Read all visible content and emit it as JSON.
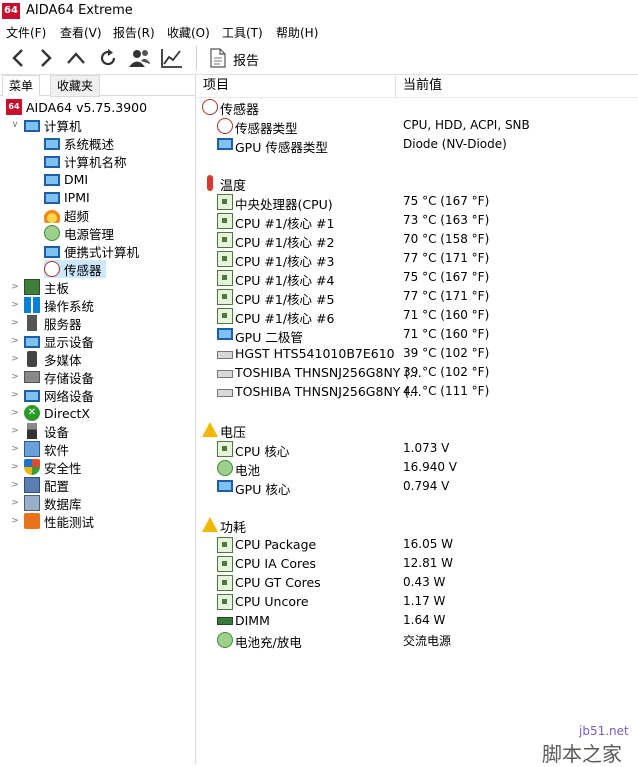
{
  "window": {
    "title": "AIDA64 Extreme",
    "logo": "64"
  },
  "menu": [
    "文件(F)",
    "查看(V)",
    "报告(R)",
    "收藏(O)",
    "工具(T)",
    "帮助(H)"
  ],
  "toolbar": {
    "buttons": [
      "back-icon",
      "forward-icon",
      "up-icon",
      "refresh-icon",
      "user-icon",
      "chart-icon"
    ],
    "report_label": "报告"
  },
  "tabs": {
    "menu": "菜单",
    "favorites": "收藏夹"
  },
  "tree": {
    "root": "AIDA64 v5.75.3900",
    "computer": "计算机",
    "computer_children": [
      "系统概述",
      "计算机名称",
      "DMI",
      "IPMI",
      "超频",
      "电源管理",
      "便携式计算机",
      "传感器"
    ],
    "top_items": [
      "主板",
      "操作系统",
      "服务器",
      "显示设备",
      "多媒体",
      "存储设备",
      "网络设备",
      "DirectX",
      "设备",
      "软件",
      "安全性",
      "配置",
      "数据库",
      "性能测试"
    ]
  },
  "columns": {
    "item": "项目",
    "value": "当前值"
  },
  "sections": {
    "sensor": {
      "title": "传感器",
      "rows": [
        {
          "label": "传感器类型",
          "value": "CPU, HDD, ACPI, SNB",
          "icon": "gauge-icon"
        },
        {
          "label": "GPU 传感器类型",
          "value": "Diode  (NV-Diode)",
          "icon": "monitor-icon"
        }
      ]
    },
    "temperature": {
      "title": "温度",
      "rows": [
        {
          "label": "中央处理器(CPU)",
          "value": "75 °C  (167 °F)",
          "icon": "chip-icon"
        },
        {
          "label": "CPU #1/核心 #1",
          "value": "73 °C  (163 °F)",
          "icon": "chip-icon"
        },
        {
          "label": "CPU #1/核心 #2",
          "value": "70 °C  (158 °F)",
          "icon": "chip-icon"
        },
        {
          "label": "CPU #1/核心 #3",
          "value": "77 °C  (171 °F)",
          "icon": "chip-icon"
        },
        {
          "label": "CPU #1/核心 #4",
          "value": "75 °C  (167 °F)",
          "icon": "chip-icon"
        },
        {
          "label": "CPU #1/核心 #5",
          "value": "77 °C  (171 °F)",
          "icon": "chip-icon"
        },
        {
          "label": "CPU #1/核心 #6",
          "value": "71 °C  (160 °F)",
          "icon": "chip-icon"
        },
        {
          "label": "GPU 二极管",
          "value": "71 °C  (160 °F)",
          "icon": "monitor-icon"
        },
        {
          "label": "HGST HTS541010B7E610",
          "value": "39 °C  (102 °F)",
          "icon": "disk-icon"
        },
        {
          "label": "TOSHIBA THNSNJ256G8NY (…",
          "value": "39 °C  (102 °F)",
          "icon": "disk-icon"
        },
        {
          "label": "TOSHIBA THNSNJ256G8NY (…",
          "value": "44 °C  (111 °F)",
          "icon": "disk-icon"
        }
      ]
    },
    "voltage": {
      "title": "电压",
      "rows": [
        {
          "label": "CPU 核心",
          "value": "1.073 V",
          "icon": "chip-icon"
        },
        {
          "label": "电池",
          "value": "16.940 V",
          "icon": "battery-icon"
        },
        {
          "label": "GPU 核心",
          "value": "0.794 V",
          "icon": "monitor-icon"
        }
      ]
    },
    "power": {
      "title": "功耗",
      "rows": [
        {
          "label": "CPU Package",
          "value": "16.05 W",
          "icon": "chip-icon"
        },
        {
          "label": "CPU IA Cores",
          "value": "12.81 W",
          "icon": "chip-icon"
        },
        {
          "label": "CPU GT Cores",
          "value": "0.43 W",
          "icon": "chip-icon"
        },
        {
          "label": "CPU Uncore",
          "value": "1.17 W",
          "icon": "chip-icon"
        },
        {
          "label": "DIMM",
          "value": "1.64 W",
          "icon": "memory-icon"
        },
        {
          "label": "电池充/放电",
          "value": "交流电源",
          "icon": "battery-icon"
        }
      ]
    }
  },
  "watermark": {
    "site": "jb51.net",
    "name": "脚本之家"
  }
}
